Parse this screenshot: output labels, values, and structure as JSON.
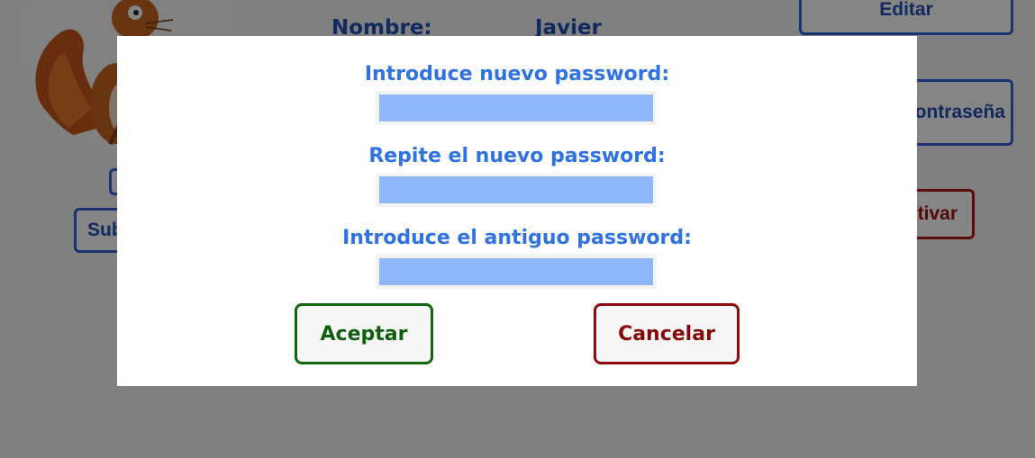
{
  "profile": {
    "name_label": "Nombre:",
    "name_value": "Javier"
  },
  "actions": {
    "edit_label": "Editar",
    "change_password_label": "Cambiar contraseña",
    "deactivate_label": "Desactivar",
    "upload_label": "Subir",
    "small_button_label": ""
  },
  "modal": {
    "new_password_label": "Introduce nuevo password:",
    "repeat_password_label": "Repite el nuevo password:",
    "old_password_label": "Introduce el antiguo password:",
    "accept_label": "Aceptar",
    "cancel_label": "Cancelar"
  },
  "colors": {
    "label_blue": "#2f72e0",
    "input_fill": "#8fb7fa",
    "accept_green": "#11680f",
    "cancel_red": "#8c0b0b"
  }
}
